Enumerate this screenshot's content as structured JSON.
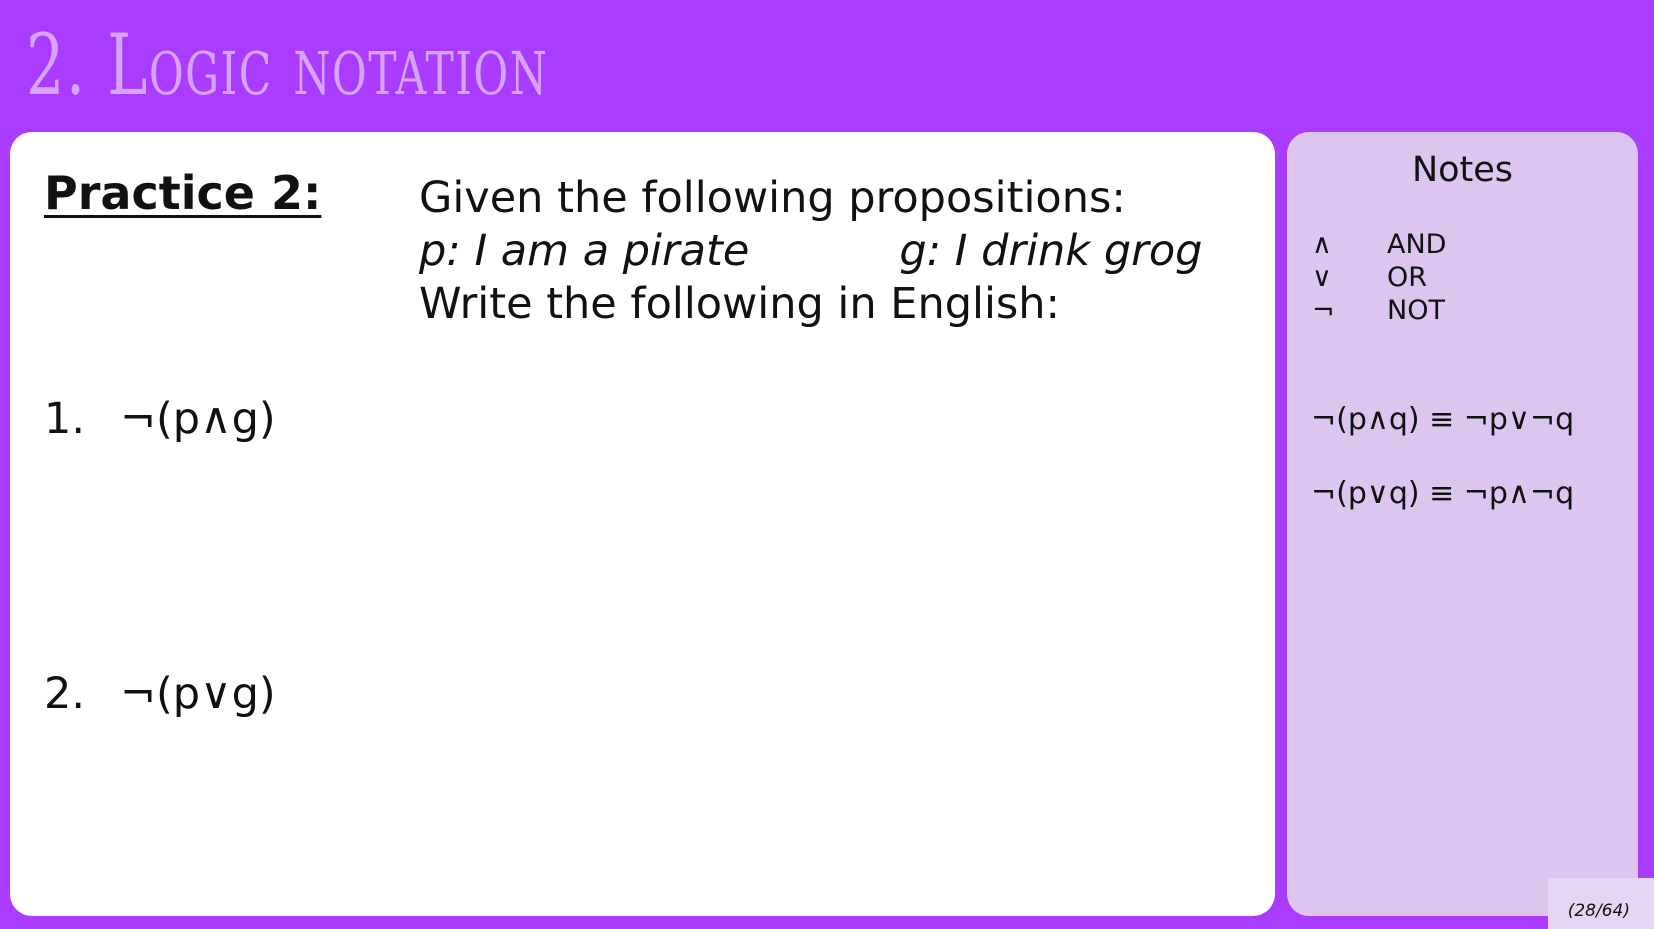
{
  "slide": {
    "title": "2. Logic notation",
    "page_indicator": "(28/64)"
  },
  "main": {
    "heading": "Practice 2:",
    "intro_line1": "Given the following propositions:",
    "prop_p": "p: I am a pirate",
    "prop_g": "g: I drink grog",
    "intro_line3": "Write the following in English:",
    "questions": [
      {
        "number": "1.",
        "expression": "¬(p∧g)"
      },
      {
        "number": "2.",
        "expression": "¬(p∨g)"
      }
    ]
  },
  "notes": {
    "title": "Notes",
    "legend": [
      {
        "symbol": "∧",
        "meaning": "AND"
      },
      {
        "symbol": "∨",
        "meaning": "OR"
      },
      {
        "symbol": "¬",
        "meaning": "NOT"
      }
    ],
    "laws": [
      "¬(p∧q) ≡ ¬p∨¬q",
      "¬(p∨q) ≡ ¬p∧¬q"
    ]
  },
  "colors": {
    "background": "#a93cff",
    "title": "#d6a3ff",
    "main_panel": "#ffffff",
    "notes_panel": "#dcc6f0"
  }
}
